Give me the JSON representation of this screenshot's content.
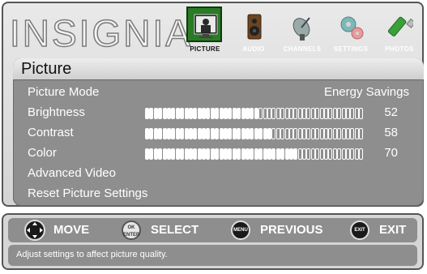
{
  "brand": "INSIGNIA",
  "tabs": [
    {
      "label": "PICTURE",
      "icon": "picture-icon",
      "active": true
    },
    {
      "label": "AUDIO",
      "icon": "speaker-icon",
      "active": false
    },
    {
      "label": "CHANNELS",
      "icon": "satellite-dish-icon",
      "active": false
    },
    {
      "label": "SETTINGS",
      "icon": "gears-icon",
      "active": false
    },
    {
      "label": "PHOTOS",
      "icon": "usb-drive-icon",
      "active": false
    }
  ],
  "panel": {
    "title": "Picture",
    "picture_mode": {
      "label": "Picture Mode",
      "value": "Energy Savings"
    },
    "brightness": {
      "label": "Brightness",
      "value": "52",
      "level": 52
    },
    "contrast": {
      "label": "Contrast",
      "value": "58",
      "level": 58
    },
    "color": {
      "label": "Color",
      "value": "70",
      "level": 70
    },
    "advanced_video": {
      "label": "Advanced Video"
    },
    "reset": {
      "label": "Reset Picture Settings"
    }
  },
  "navbar": {
    "move": {
      "label": "MOVE"
    },
    "select": {
      "label": "SELECT",
      "button": "OK ENTER"
    },
    "previous": {
      "label": "PREVIOUS",
      "button": "MENU"
    },
    "exit": {
      "label": "EXIT",
      "button": "EXIT"
    }
  },
  "status": "Adjust settings to affect picture quality."
}
